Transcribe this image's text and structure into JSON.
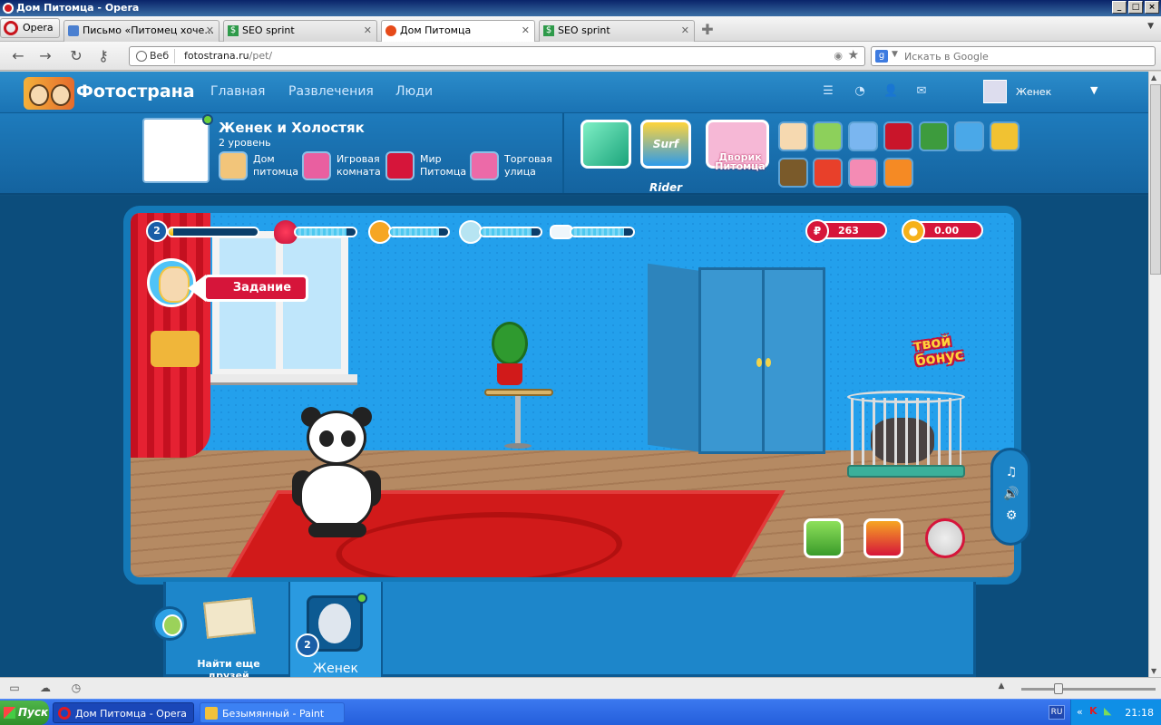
{
  "window": {
    "title": "Дом Питомца - Opera"
  },
  "tabs": [
    {
      "label": "Opera",
      "kind": "menu"
    },
    {
      "label": "Письмо «Питомец хоче...",
      "icon": "mail-icon"
    },
    {
      "label": "SEO sprint",
      "icon": "dollar-icon"
    },
    {
      "label": "Дом Питомца",
      "icon": "opera-icon",
      "active": true
    },
    {
      "label": "SEO sprint",
      "icon": "dollar-icon"
    }
  ],
  "addressbar": {
    "web_label": "Веб",
    "url_host": "fotostrana.ru",
    "url_path": "/pet/"
  },
  "search": {
    "placeholder": "Искать в Google",
    "engine": "g"
  },
  "site": {
    "logo": "Фотострана",
    "nav": [
      "Главная",
      "Развлечения",
      "Люди"
    ],
    "username": "Женек"
  },
  "pet": {
    "name": "Женек и Холостяк",
    "level": "2 уровень",
    "nav": [
      {
        "label": "Дом питомца"
      },
      {
        "label": "Игровая комната"
      },
      {
        "label": "Мир Питомца"
      },
      {
        "label": "Торговая улица"
      }
    ],
    "dvorik": "Дворик Питомца",
    "surf": "Surf Rider"
  },
  "game": {
    "level": "2",
    "bar_fills": {
      "xp": 0.05,
      "health": 0.85,
      "mood": 0.85,
      "hunger": 0.85,
      "clean": 0.85
    },
    "coins_rub": "263",
    "coins_gold": "0.00",
    "quest_label": "Задание",
    "bonus_line1": "твой",
    "bonus_line2": "бонус"
  },
  "bottom": {
    "find_friends": "Найти еще друзей",
    "slot_level": "2",
    "slot_name": "Женек"
  },
  "taskbar": {
    "start": "Пуск",
    "tasks": [
      "Дом Питомца - Opera",
      "Безымянный - Paint"
    ],
    "lang": "RU",
    "clock": "21:18"
  },
  "colors": {
    "accent": "#1a73b4",
    "red": "#d6153a",
    "green": "#6cd13b"
  }
}
